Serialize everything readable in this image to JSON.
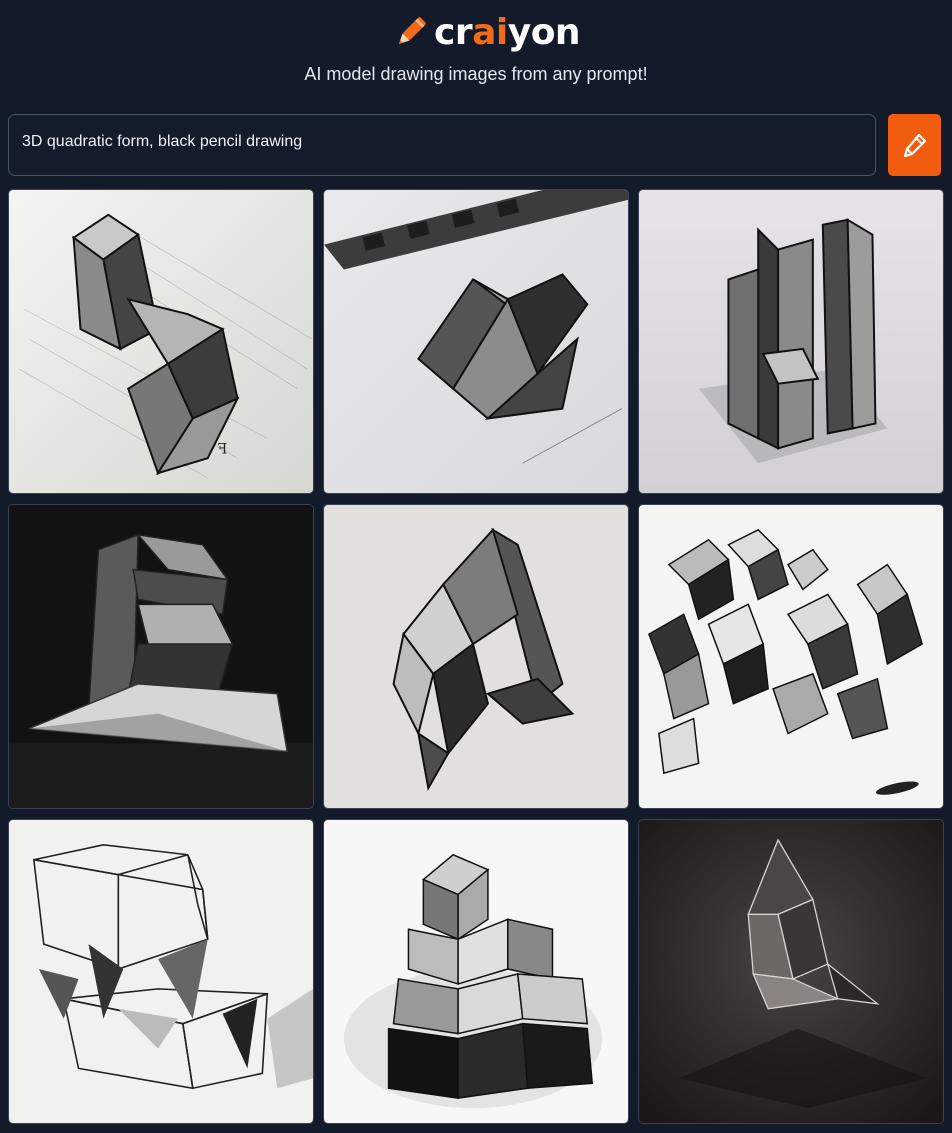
{
  "header": {
    "logo": {
      "part1": "cr",
      "part2": "ai",
      "part3": "yon"
    },
    "tagline": "AI model drawing images from any prompt!"
  },
  "prompt": {
    "value": "3D quadratic form, black pencil drawing"
  },
  "draw_button": {
    "icon": "pencil-icon"
  },
  "colors": {
    "background": "#131a2a",
    "accent": "#f25c0f",
    "brand_orange": "#f26b1d",
    "text": "#e8ebf2"
  },
  "results": {
    "count": 9,
    "images": [
      {
        "id": "result-1",
        "style": "light"
      },
      {
        "id": "result-2",
        "style": "light"
      },
      {
        "id": "result-3",
        "style": "light"
      },
      {
        "id": "result-4",
        "style": "dark"
      },
      {
        "id": "result-5",
        "style": "light"
      },
      {
        "id": "result-6",
        "style": "light"
      },
      {
        "id": "result-7",
        "style": "light"
      },
      {
        "id": "result-8",
        "style": "light"
      },
      {
        "id": "result-9",
        "style": "dark"
      }
    ]
  }
}
